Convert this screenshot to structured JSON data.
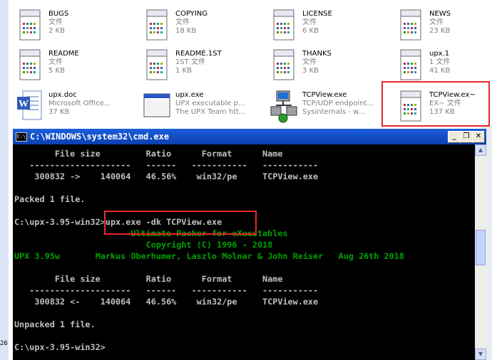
{
  "files": [
    {
      "name": "BUGS",
      "sub1": "文件",
      "sub2": "2 KB",
      "icon": "text-file-icon"
    },
    {
      "name": "COPYING",
      "sub1": "文件",
      "sub2": "18 KB",
      "icon": "text-file-icon"
    },
    {
      "name": "LICENSE",
      "sub1": "文件",
      "sub2": "6 KB",
      "icon": "text-file-icon"
    },
    {
      "name": "NEWS",
      "sub1": "文件",
      "sub2": "23 KB",
      "icon": "text-file-icon"
    },
    {
      "name": "README",
      "sub1": "文件",
      "sub2": "5 KB",
      "icon": "text-file-icon"
    },
    {
      "name": "README.1ST",
      "sub1": "1ST 文件",
      "sub2": "1 KB",
      "icon": "text-file-icon"
    },
    {
      "name": "THANKS",
      "sub1": "文件",
      "sub2": "3 KB",
      "icon": "text-file-icon"
    },
    {
      "name": "upx.1",
      "sub1": "1 文件",
      "sub2": "41 KB",
      "icon": "text-file-icon"
    },
    {
      "name": "upx.doc",
      "sub1": "Microsoft Office...",
      "sub2": "37 KB",
      "icon": "word-doc-icon"
    },
    {
      "name": "upx.exe",
      "sub1": "UPX executable p...",
      "sub2": "The UPX Team htt...",
      "icon": "exe-window-icon"
    },
    {
      "name": "TCPView.exe",
      "sub1": "TCP/UDP endpoint...",
      "sub2": "Sysinternals - w...",
      "icon": "tcpview-icon"
    },
    {
      "name": "TCPView.ex~",
      "sub1": "EX~ 文件",
      "sub2": "137 KB",
      "icon": "text-file-icon"
    }
  ],
  "cmd": {
    "title": "C:\\WINDOWS\\system32\\cmd.exe",
    "app_icon_text": "C:\\",
    "buttons": {
      "minimize": "_",
      "restore": "❐",
      "close": "✕"
    },
    "lines": [
      {
        "text": "        File size         Ratio      Format      Name",
        "style": "normal"
      },
      {
        "text": "   --------------------   ------   -----------   -----------",
        "style": "normal"
      },
      {
        "text": "    300832 ->    140064   46.56%    win32/pe     TCPView.exe",
        "style": "normal"
      },
      {
        "text": "",
        "style": "normal"
      },
      {
        "text": "Packed 1 file.",
        "style": "normal"
      },
      {
        "text": "",
        "style": "normal"
      },
      {
        "text": "C:\\upx-3.95-win32>upx.exe -dk TCPView.exe",
        "style": "normal"
      },
      {
        "text": "                       Ultimate Packer for eXecutables",
        "style": "green"
      },
      {
        "text": "                          Copyright (C) 1996 - 2018",
        "style": "green"
      },
      {
        "text": "UPX 3.95w       Markus Oberhumer, Laszlo Molnar & John Reiser   Aug 26th 2018",
        "style": "green"
      },
      {
        "text": "",
        "style": "normal"
      },
      {
        "text": "        File size         Ratio      Format      Name",
        "style": "normal"
      },
      {
        "text": "   --------------------   ------   -----------   -----------",
        "style": "normal"
      },
      {
        "text": "    300832 <-    140064   46.56%    win32/pe     TCPView.exe",
        "style": "normal"
      },
      {
        "text": "",
        "style": "normal"
      },
      {
        "text": "Unpacked 1 file.",
        "style": "normal"
      },
      {
        "text": "",
        "style": "normal"
      },
      {
        "text": "C:\\upx-3.95-win32>",
        "style": "normal"
      }
    ]
  },
  "side_number": "26",
  "colors": {
    "highlight": "#e8292c",
    "title_bar": "#0b3fb0",
    "console_text": "#c0c0c0",
    "console_green": "#00a000"
  }
}
